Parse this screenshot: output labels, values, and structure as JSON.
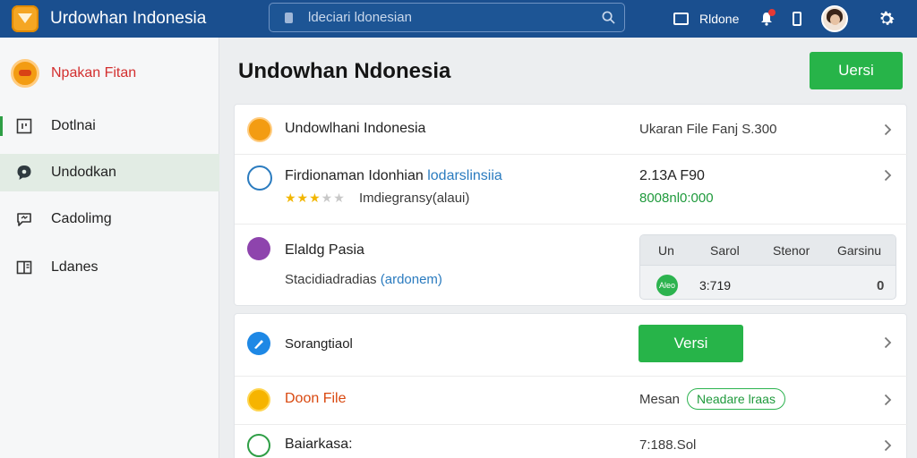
{
  "topbar": {
    "app_title": "Urdowhan Indonesia",
    "search_placeholder": "ldeciari ldonesian",
    "user_label": "Rldone"
  },
  "sidebar": {
    "header_label": "Npakan Fitan",
    "items": [
      {
        "label": "Dotlnai",
        "icon": "dashboard-icon",
        "active": false
      },
      {
        "label": "Undodkan",
        "icon": "download-icon",
        "active": true
      },
      {
        "label": "Cadolimg",
        "icon": "chat-icon",
        "active": false
      },
      {
        "label": "Ldanes",
        "icon": "book-icon",
        "active": false
      }
    ]
  },
  "main": {
    "title": "Undowhan Ndonesia",
    "primary_button": "Uersi",
    "card1": {
      "row1": {
        "title": "Undowlhani Indonesia",
        "meta": "Ukaran File Fanj S.300"
      },
      "row2": {
        "title": "Firdionaman Idonhian",
        "link": "lodarslinsiia",
        "rating": 3.5,
        "rating_note": "Imdiegransy(alaui)",
        "size": "2.13A F90",
        "count": "8008nl0:000"
      },
      "row3": {
        "title": "Elaldg Pasia",
        "subtitle": "Stacidiadradias",
        "subtitle_link": "(ardonem)",
        "table_headers": [
          "Un",
          "Sarol",
          "Stenor",
          "Garsinu"
        ],
        "table_badge": "Aleo",
        "table_value": "3:719",
        "table_count": "0"
      }
    },
    "card2": {
      "row1": {
        "title": "Sorangtiaol",
        "button": "Versi"
      },
      "row2": {
        "title": "Doon File",
        "meta": "Mesan",
        "pill": "Neadare lraas"
      },
      "row3": {
        "title": "Baiarkasa:",
        "meta": "7:188.Sol"
      }
    }
  },
  "colors": {
    "topbar": "#1a4f8f",
    "accent_green": "#27b449",
    "sidebar_header": "#d32f2f",
    "link_blue": "#2a7bbf"
  }
}
